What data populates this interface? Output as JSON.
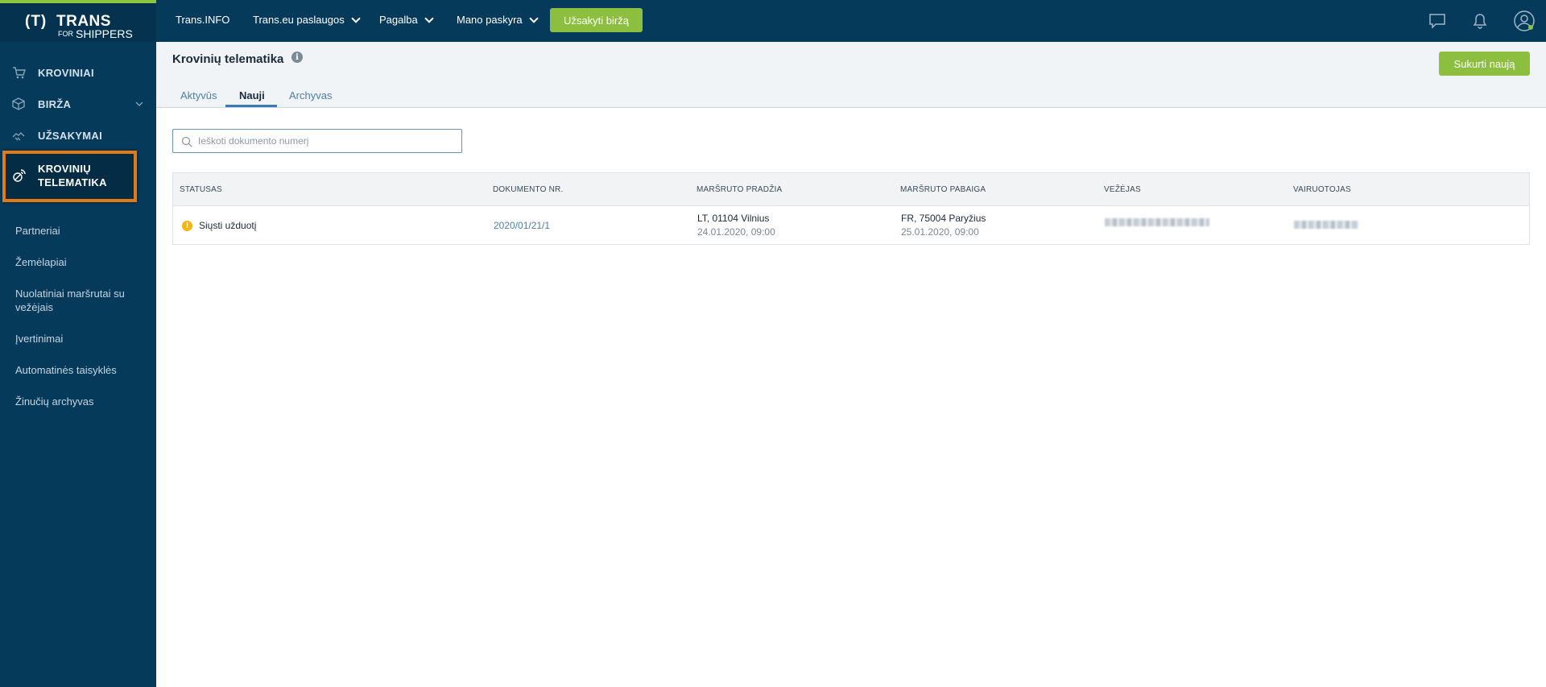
{
  "logo": {
    "mark": "(T)",
    "trans": "TRANS",
    "for": "FOR",
    "shippers": "SHIPPERS"
  },
  "sidebar": {
    "main_items": [
      {
        "label": "KROVINIAI",
        "icon": "cart-icon"
      },
      {
        "label": "BIRŽA",
        "icon": "box-icon",
        "has_chevron": true
      },
      {
        "label": "UŽSAKYMAI",
        "icon": "handshake-icon"
      }
    ],
    "active_item": {
      "label_line1": "KROVINIŲ",
      "label_line2": "TELEMATIKA",
      "icon": "satellite-icon"
    },
    "sub_items": [
      "Partneriai",
      "Žemėlapiai",
      "Nuolatiniai maršrutai su vežėjais",
      "Įvertinimai",
      "Automatinės taisyklės",
      "Žinučių archyvas"
    ]
  },
  "topbar": {
    "links": [
      "Trans.INFO",
      "Trans.eu paslaugos",
      "Pagalba",
      "Mano paskyra"
    ],
    "order_button": "Užsakyti biržą",
    "icons": [
      "chat-icon",
      "bell-icon",
      "user-avatar-icon"
    ]
  },
  "page": {
    "title": "Krovinių telematika",
    "create_button": "Sukurti naują",
    "tabs": [
      "Aktyvūs",
      "Nauji",
      "Archyvas"
    ],
    "active_tab": "Nauji"
  },
  "search": {
    "placeholder": "Ieškoti dokumento numerį"
  },
  "table": {
    "headers": [
      "STATUSAS",
      "DOKUMENTO NR.",
      "MARŠRUTO PRADŽIA",
      "MARŠRUTO PABAIGA",
      "VEŽĖJAS",
      "VAIRUOTOJAS"
    ],
    "rows": [
      {
        "status": "Siųsti užduotį",
        "document": "2020/01/21/1",
        "start_place": "LT, 01104 Vilnius",
        "start_time": "24.01.2020, 09:00",
        "end_place": "FR, 75004 Paryžius",
        "end_time": "25.01.2020, 09:00"
      }
    ]
  },
  "colors": {
    "sidebar": "#063a5b",
    "accent_green": "#8cbf3f",
    "highlight_orange": "#e07b18",
    "link_blue": "#4d7ea6"
  }
}
